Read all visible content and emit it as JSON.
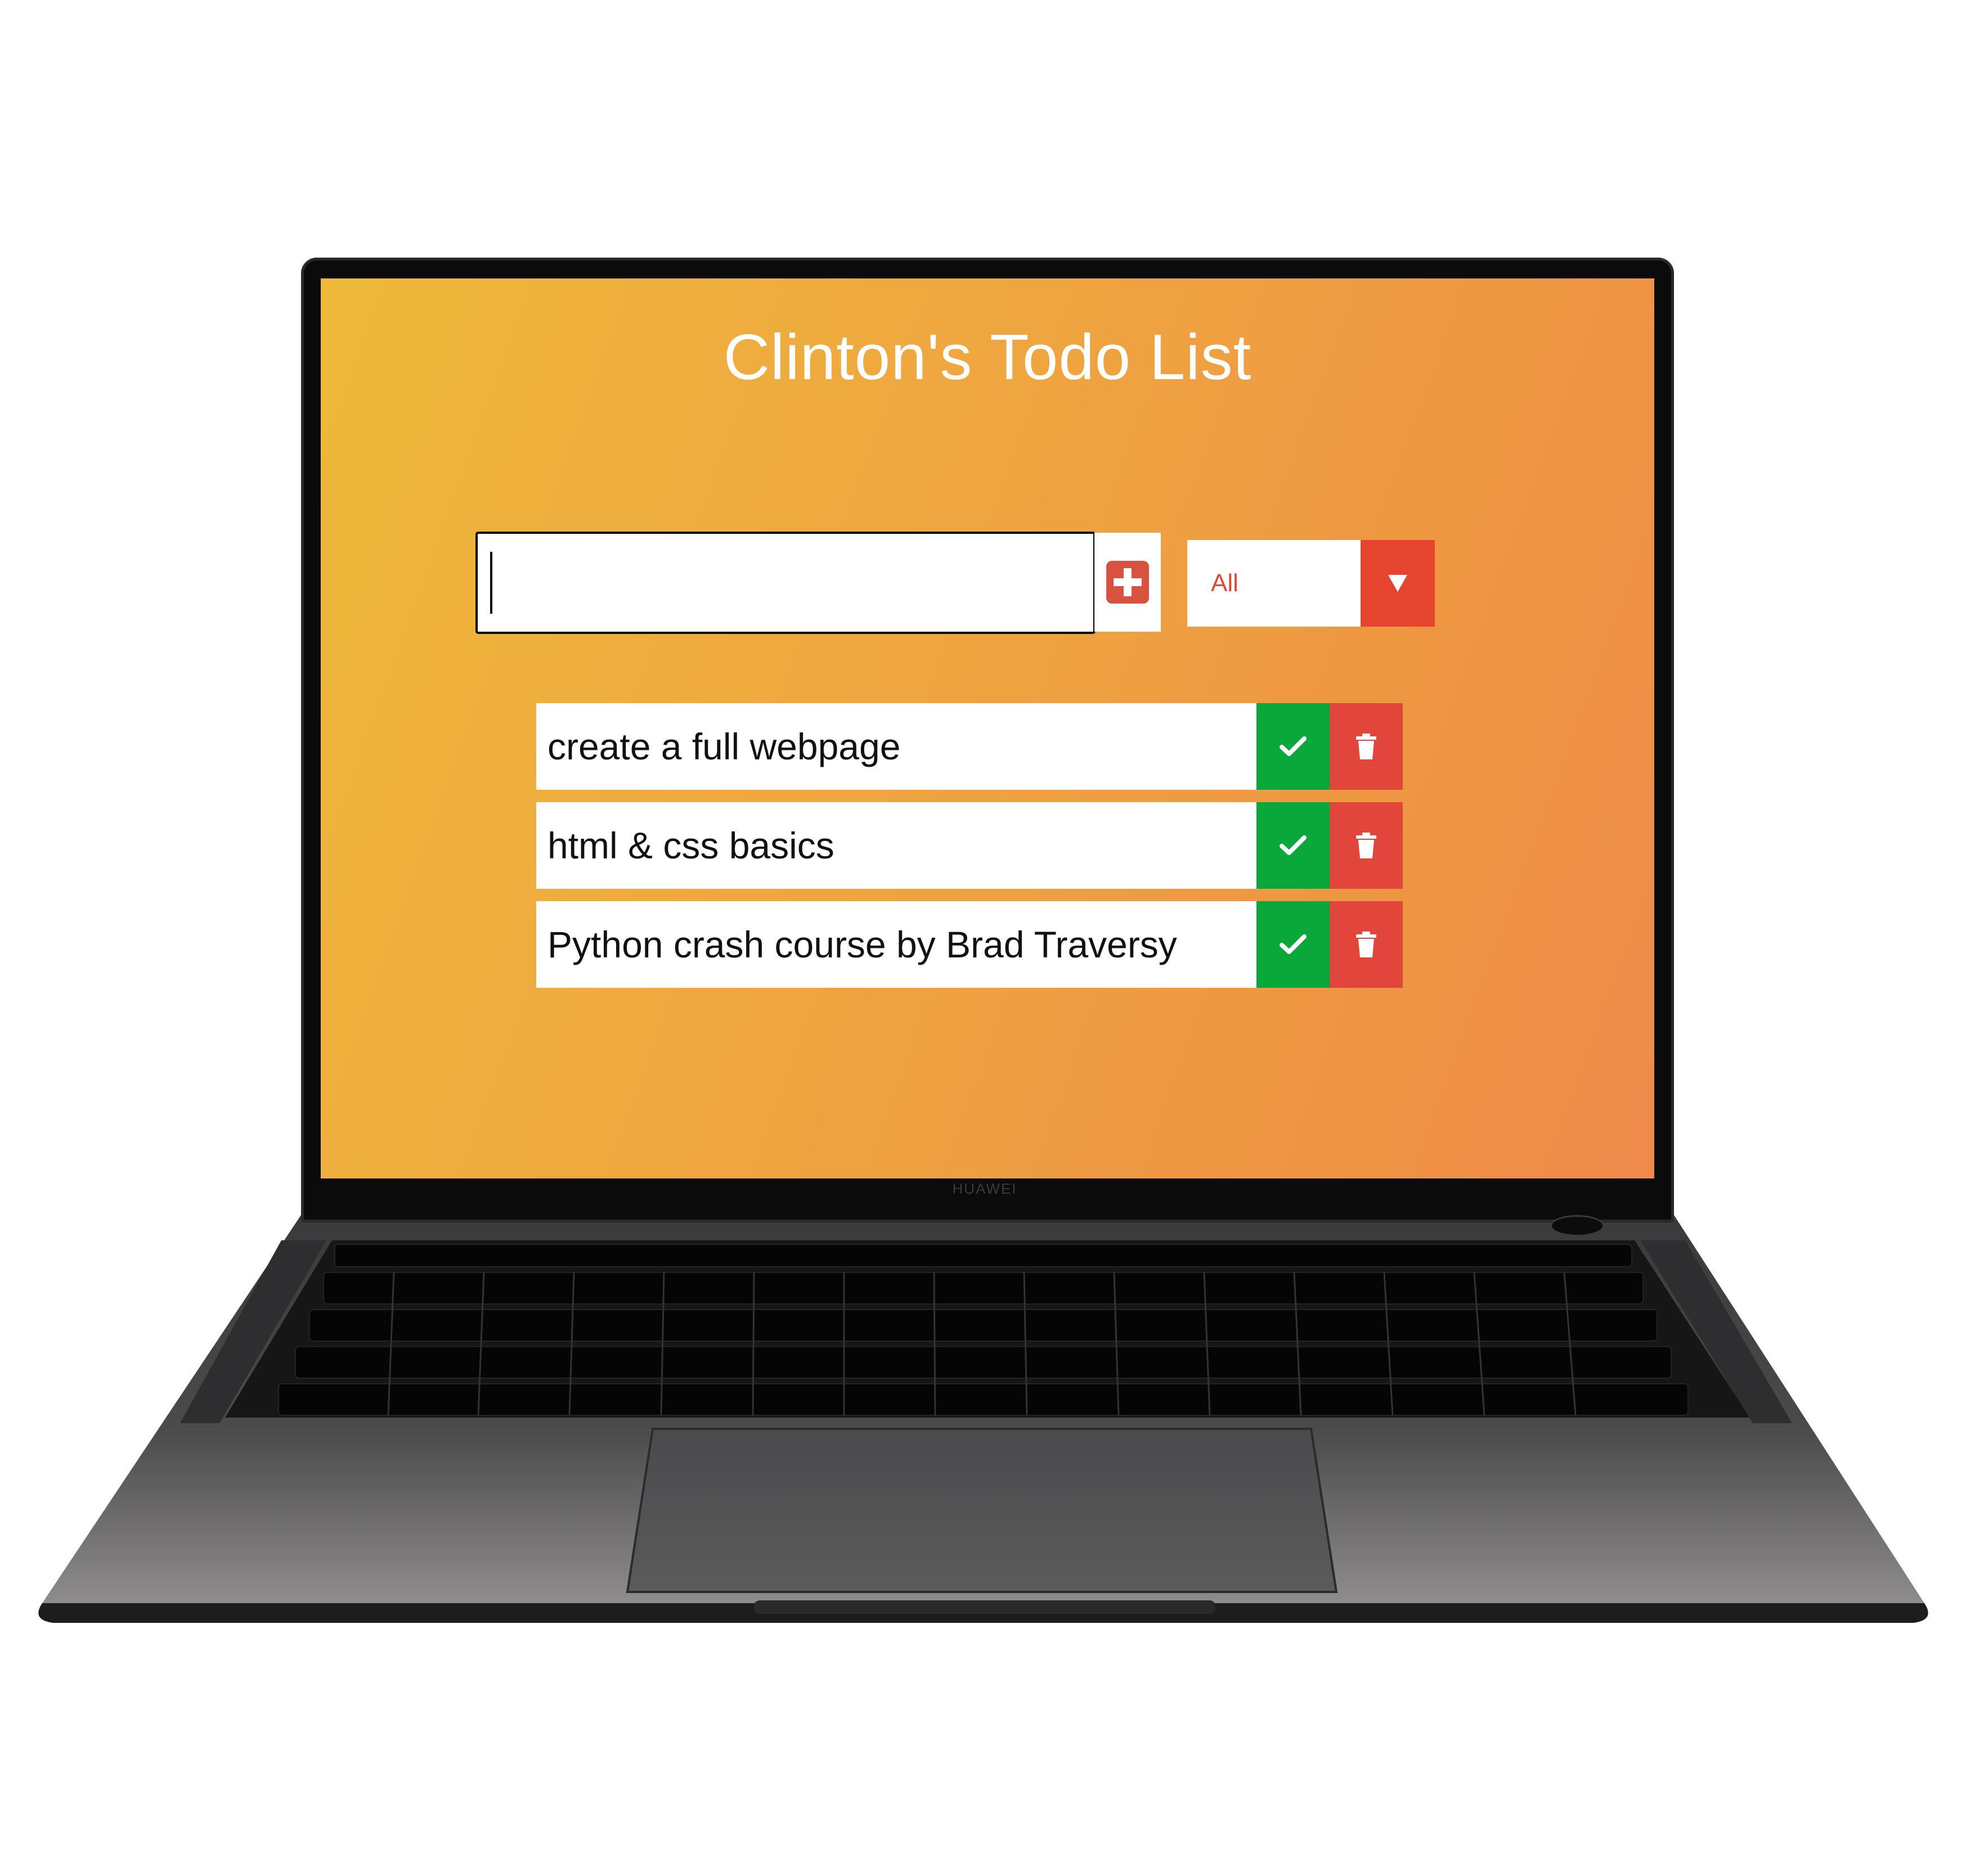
{
  "device": {
    "brand": "HUAWEI"
  },
  "app": {
    "title": "Clinton's Todo List",
    "input": {
      "value": "",
      "placeholder": ""
    },
    "add_button_icon": "plus-square-icon",
    "filter": {
      "selected": "All"
    },
    "todos": [
      {
        "text": "create a full webpage",
        "complete_icon": "check-icon",
        "delete_icon": "trash-icon"
      },
      {
        "text": "html & css basics",
        "complete_icon": "check-icon",
        "delete_icon": "trash-icon"
      },
      {
        "text": "Python crash course by Brad Traversy",
        "complete_icon": "check-icon",
        "delete_icon": "trash-icon"
      }
    ],
    "colors": {
      "background_start": "#eeb93a",
      "background_end": "#ee8a4b",
      "accent_red": "#e5442f",
      "complete_green": "#0aa83a"
    }
  }
}
